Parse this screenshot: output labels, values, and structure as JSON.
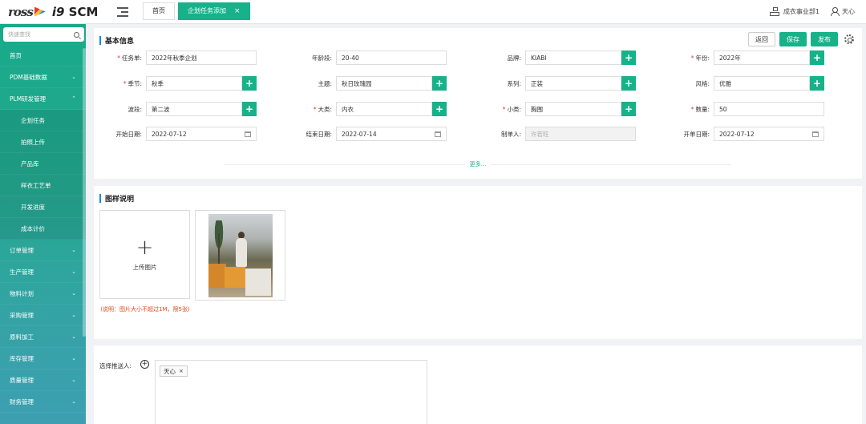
{
  "logo": {
    "brand": "ross",
    "brand_sub": "罗斯服饰",
    "product_prefix": "i9",
    "product": "SCM"
  },
  "tabs": [
    {
      "label": "首页"
    },
    {
      "label": "企划任务添加",
      "close": "×"
    }
  ],
  "top_right": {
    "org": "成衣事业部1",
    "user": "天心"
  },
  "sidebar": {
    "search_placeholder": "快速查找",
    "items": [
      {
        "label": "首页",
        "chevron": ""
      },
      {
        "label": "PDM基础数据",
        "chevron": "⌄"
      },
      {
        "label": "PLM研发管理",
        "chevron": "⌃"
      }
    ],
    "sub_items": [
      {
        "label": "企划任务"
      },
      {
        "label": "拍照上传"
      },
      {
        "label": "产品库"
      },
      {
        "label": "样衣工艺单"
      },
      {
        "label": "开发进度"
      },
      {
        "label": "成本计价"
      }
    ],
    "bottom_items": [
      {
        "label": "订单管理",
        "chevron": "⌄"
      },
      {
        "label": "生产管理",
        "chevron": "⌄"
      },
      {
        "label": "物料计划",
        "chevron": "⌄"
      },
      {
        "label": "采购管理",
        "chevron": "⌄"
      },
      {
        "label": "原料加工",
        "chevron": "⌄"
      },
      {
        "label": "库存管理",
        "chevron": "⌄"
      },
      {
        "label": "质量管理",
        "chevron": "⌄"
      },
      {
        "label": "财务管理",
        "chevron": "⌄"
      }
    ]
  },
  "basic": {
    "title": "基本信息",
    "buttons": {
      "back": "返回",
      "save": "保存",
      "publish": "发布"
    },
    "fields": {
      "task_no": {
        "label": "任务单:",
        "value": "2022年秋季企划",
        "required": "*"
      },
      "age_group": {
        "label": "年龄段:",
        "value": "20-40"
      },
      "brand": {
        "label": "品牌:",
        "value": "KIABI"
      },
      "year": {
        "label": "年份:",
        "value": "2022年",
        "required": "*"
      },
      "season": {
        "label": "季节:",
        "value": "秋季",
        "required": "*"
      },
      "theme": {
        "label": "主题:",
        "value": "秋日玫瑰园"
      },
      "series": {
        "label": "系列:",
        "value": "正装"
      },
      "style": {
        "label": "风格:",
        "value": "优雅"
      },
      "wave": {
        "label": "波段:",
        "value": "第二波"
      },
      "category": {
        "label": "大类:",
        "value": "内衣",
        "required": "*"
      },
      "subcategory": {
        "label": "小类:",
        "value": "胸围",
        "required": "*"
      },
      "quantity": {
        "label": "数量:",
        "value": "50",
        "required": "*"
      },
      "start_date": {
        "label": "开始日期:",
        "value": "2022-07-12"
      },
      "end_date": {
        "label": "结束日期:",
        "value": "2022-07-14"
      },
      "creator": {
        "label": "制单人:",
        "placeholder": "许若旺"
      },
      "order_date": {
        "label": "开单日期:",
        "value": "2022-07-12"
      }
    },
    "more": "更多..."
  },
  "pictures": {
    "title": "图样说明",
    "upload_plus": "+",
    "upload_label": "上传图片",
    "hint": "(说明：图片大小不超过1M，限5张)"
  },
  "assign": {
    "label": "选择推送人:",
    "add_symbol": "+",
    "tag": "天心",
    "tag_close": "×"
  }
}
